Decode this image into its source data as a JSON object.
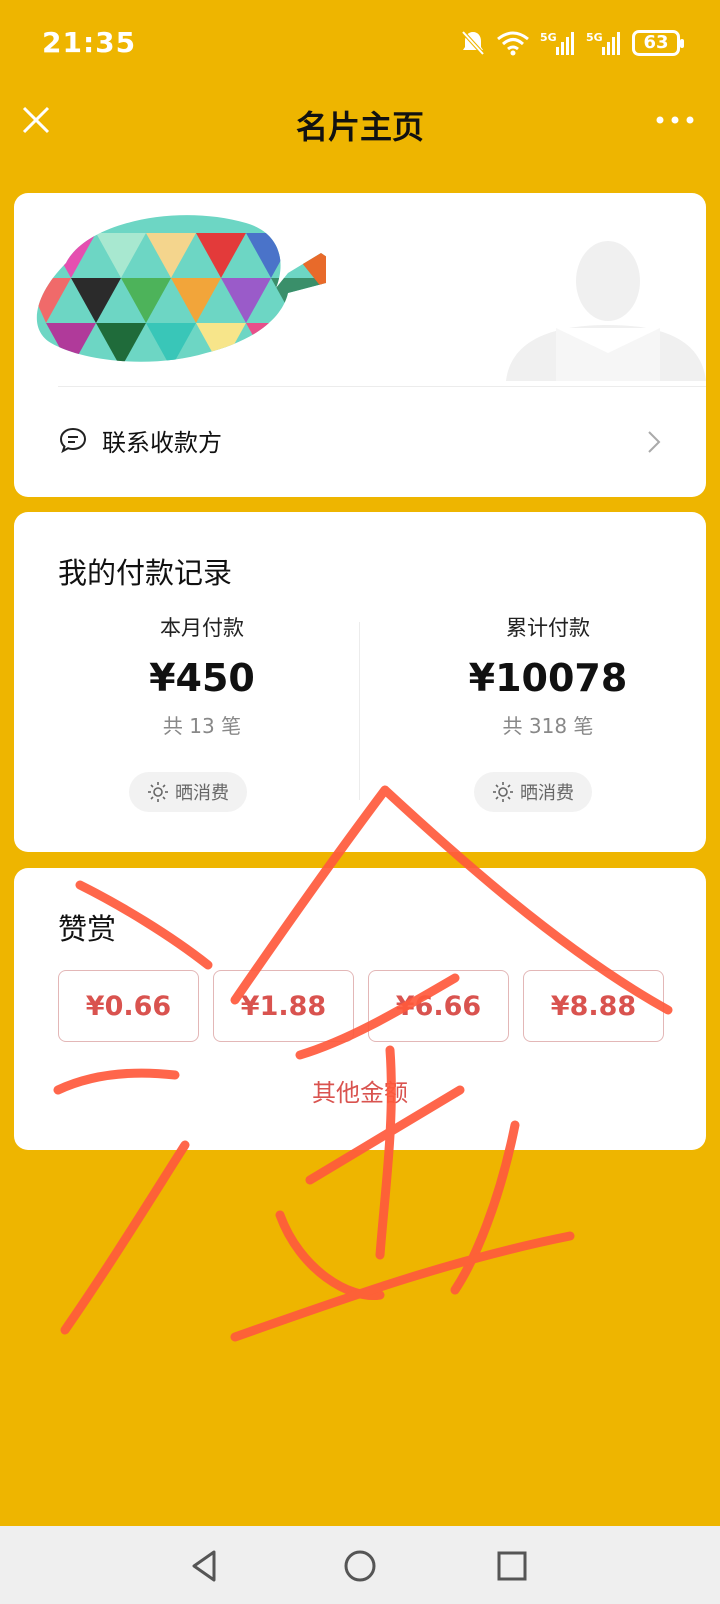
{
  "status_bar": {
    "time": "21:35",
    "battery": "63"
  },
  "nav": {
    "title": "名片主页"
  },
  "profile": {
    "contact_label": "联系收款方"
  },
  "records": {
    "title": "我的付款记录",
    "month": {
      "label": "本月付款",
      "amount": "¥450",
      "count": "共 13 笔"
    },
    "total": {
      "label": "累计付款",
      "amount": "¥10078",
      "count": "共 318 笔"
    },
    "share_label": "晒消费"
  },
  "reward": {
    "title": "赞赏",
    "amounts": [
      "¥0.66",
      "¥1.88",
      "¥6.66",
      "¥8.88"
    ],
    "other": "其他金额"
  },
  "colors": {
    "background": "#EEB500",
    "accent_red": "#D9534F",
    "scribble": "#FF5A3C"
  }
}
